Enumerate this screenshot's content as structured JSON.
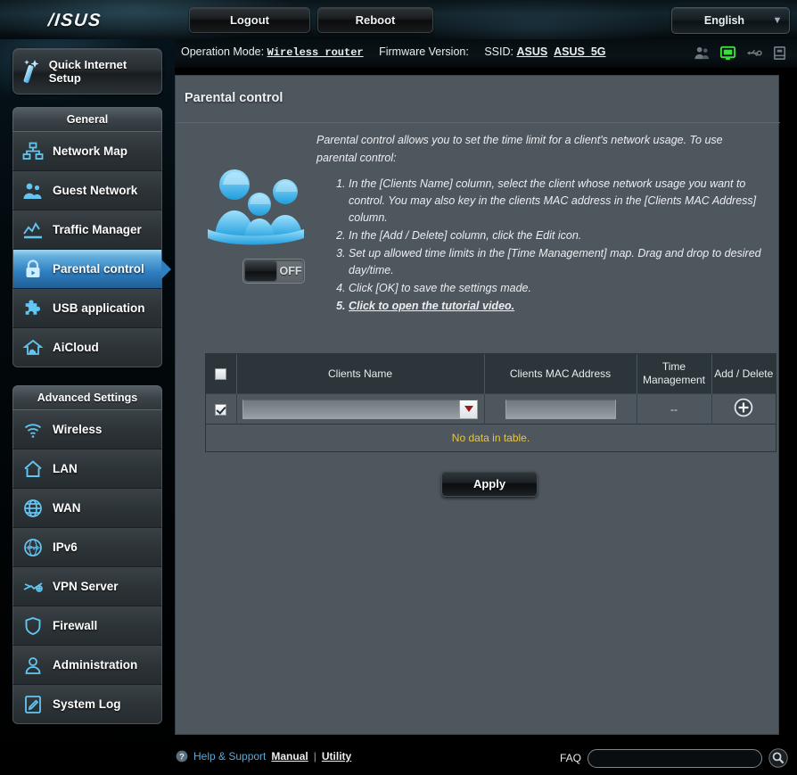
{
  "brand": {
    "logo_text": "/ISUS"
  },
  "topbar": {
    "logout_label": "Logout",
    "reboot_label": "Reboot",
    "language": "English",
    "caret_icon": "chevron-down-icon"
  },
  "opbar": {
    "operation_mode_label": "Operation Mode:",
    "operation_mode_value": "Wireless router",
    "firmware_label": "Firmware Version:",
    "firmware_value": "",
    "ssid_label": "SSID:",
    "ssid_values": [
      "ASUS",
      "ASUS_5G"
    ],
    "status_icons": [
      "clients-icon",
      "monitor-icon",
      "usb-icon",
      "printer-icon"
    ],
    "active_icon_color": "#3ddc3d"
  },
  "sidebar": {
    "quick_setup": {
      "label": "Quick Internet Setup",
      "icon": "wand-icon"
    },
    "groups": [
      {
        "title": "General",
        "items": [
          {
            "label": "Network Map",
            "icon": "network-map-icon",
            "active": false
          },
          {
            "label": "Guest Network",
            "icon": "guest-network-icon",
            "active": false
          },
          {
            "label": "Traffic Manager",
            "icon": "traffic-manager-icon",
            "active": false
          },
          {
            "label": "Parental control",
            "icon": "lock-icon",
            "active": true
          },
          {
            "label": "USB application",
            "icon": "puzzle-icon",
            "active": false
          },
          {
            "label": "AiCloud",
            "icon": "cloud-icon",
            "active": false
          }
        ]
      },
      {
        "title": "Advanced Settings",
        "items": [
          {
            "label": "Wireless",
            "icon": "wifi-icon",
            "active": false
          },
          {
            "label": "LAN",
            "icon": "home-icon",
            "active": false
          },
          {
            "label": "WAN",
            "icon": "globe-icon",
            "active": false
          },
          {
            "label": "IPv6",
            "icon": "ipv6-globe-icon",
            "active": false
          },
          {
            "label": "VPN Server",
            "icon": "vpn-icon",
            "active": false
          },
          {
            "label": "Firewall",
            "icon": "shield-icon",
            "active": false
          },
          {
            "label": "Administration",
            "icon": "user-icon",
            "active": false
          },
          {
            "label": "System Log",
            "icon": "edit-document-icon",
            "active": false
          }
        ]
      }
    ]
  },
  "main": {
    "page_title": "Parental control",
    "intro": "Parental control allows you to set the time limit for a client's network usage. To use parental control:",
    "steps": [
      "In the [Clients Name] column, select the client whose network usage you want to control. You may also key in the clients MAC address in the [Clients MAC Address] column.",
      "In the [Add / Delete] column, click the Edit icon.",
      "Set up allowed time limits in the [Time Management] map. Drag and drop to desired day/time.",
      "Click [OK] to save the settings made.",
      "Click to open the tutorial video."
    ],
    "tutorial_step_index": 4,
    "family_icon": "family-icon",
    "toggle": {
      "state_label": "OFF",
      "enabled": false
    },
    "table": {
      "headers": [
        "",
        "Clients Name",
        "Clients MAC Address",
        "Time Management",
        "Add / Delete"
      ],
      "header_checkbox_checked": false,
      "row": {
        "checkbox_checked": true,
        "client_name_value": "",
        "client_name_placeholder": "",
        "mac_value": "",
        "mac_placeholder": "",
        "time_management": "--",
        "add_icon": "plus-circle-icon",
        "dropdown_icon": "caret-down-icon"
      },
      "empty_message": "No data in table.",
      "empty_message_color": "#e8c547"
    },
    "apply_label": "Apply"
  },
  "footer": {
    "help_icon": "question-circle-icon",
    "help_text": "Help & Support",
    "manual_link": "Manual",
    "separator": "|",
    "utility_link": "Utility",
    "faq_label": "FAQ",
    "faq_value": "",
    "faq_placeholder": "",
    "search_icon": "search-icon"
  }
}
